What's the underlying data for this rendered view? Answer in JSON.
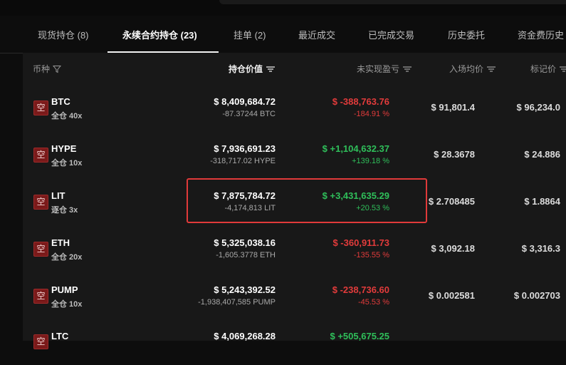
{
  "tabs": [
    {
      "label": "现货持仓 (8)"
    },
    {
      "label": "永续合约持仓 (23)"
    },
    {
      "label": "挂单 (2)"
    },
    {
      "label": "最近成交"
    },
    {
      "label": "已完成交易"
    },
    {
      "label": "历史委托"
    },
    {
      "label": "资金费历史"
    }
  ],
  "active_tab": 1,
  "headers": {
    "coin": "币种",
    "position_value": "持仓价值",
    "unrealized_pnl": "未实现盈亏",
    "entry_price": "入场均价",
    "mark_price": "标记价"
  },
  "short_badge": "空",
  "colors": {
    "loss": "#e23b3b",
    "profit": "#2fbf5a",
    "highlight": "#e03a3a"
  },
  "rows": [
    {
      "symbol": "BTC",
      "leverage": "全仓 40x",
      "value": "$ 8,409,684.72",
      "qty": "-87.37244 BTC",
      "pnl": "$ -388,763.76",
      "pct": "-184.91 %",
      "trend": "loss",
      "entry": "$ 91,801.4",
      "mark": "$ 96,234.0"
    },
    {
      "symbol": "HYPE",
      "leverage": "全仓 10x",
      "value": "$ 7,936,691.23",
      "qty": "-318,717.02 HYPE",
      "pnl": "$ +1,104,632.37",
      "pct": "+139.18 %",
      "trend": "profit",
      "entry": "$ 28.3678",
      "mark": "$ 24.886"
    },
    {
      "symbol": "LIT",
      "leverage": "逐仓 3x",
      "value": "$ 7,875,784.72",
      "qty": "-4,174,813 LIT",
      "pnl": "$ +3,431,635.29",
      "pct": "+20.53 %",
      "trend": "profit",
      "entry": "$ 2.708485",
      "mark": "$ 1.8864"
    },
    {
      "symbol": "ETH",
      "leverage": "全仓 20x",
      "value": "$ 5,325,038.16",
      "qty": "-1,605.3778 ETH",
      "pnl": "$ -360,911.73",
      "pct": "-135.55 %",
      "trend": "loss",
      "entry": "$ 3,092.18",
      "mark": "$ 3,316.3"
    },
    {
      "symbol": "PUMP",
      "leverage": "全仓 10x",
      "value": "$ 5,243,392.52",
      "qty": "-1,938,407,585 PUMP",
      "pnl": "$ -238,736.60",
      "pct": "-45.53 %",
      "trend": "loss",
      "entry": "$ 0.002581",
      "mark": "$ 0.002703"
    },
    {
      "symbol": "LTC",
      "leverage": "",
      "value": "$ 4,069,268.28",
      "qty": "",
      "pnl": "$ +505,675.25",
      "pct": "",
      "trend": "profit",
      "entry": "",
      "mark": ""
    }
  ]
}
